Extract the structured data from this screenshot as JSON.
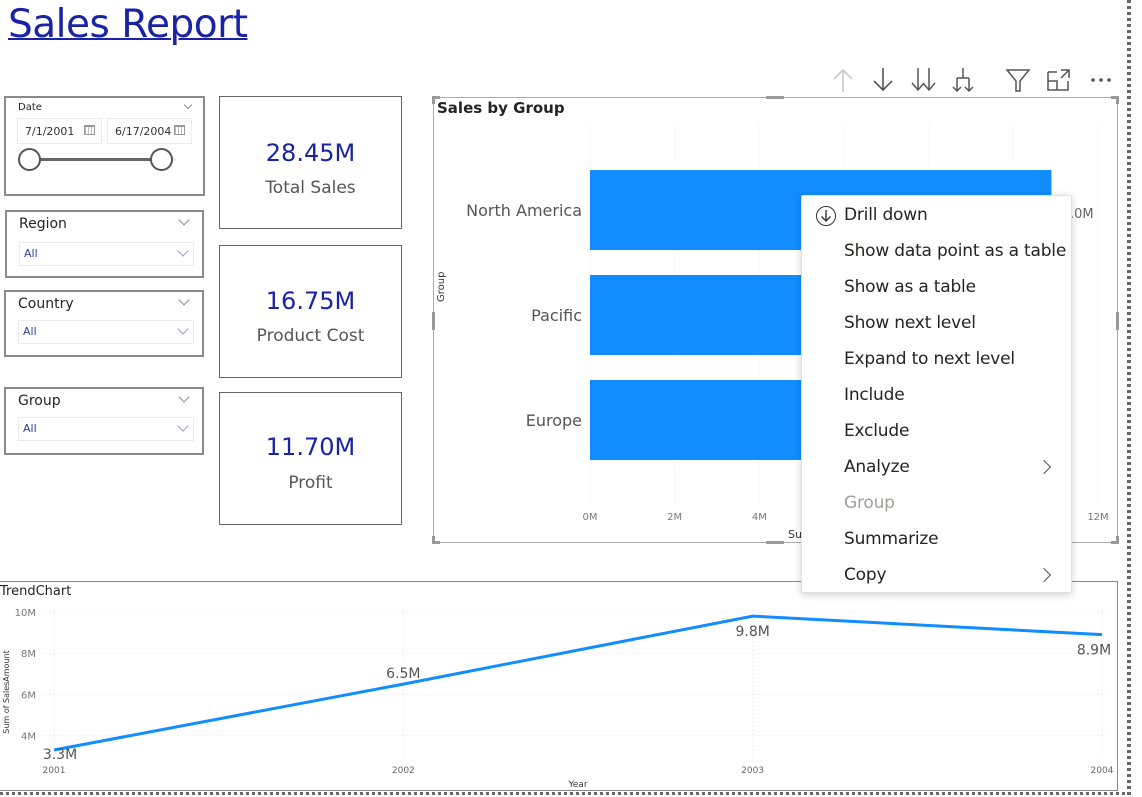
{
  "report": {
    "title": "Sales Report"
  },
  "slicers": {
    "date": {
      "label": "Date",
      "start": "7/1/2001",
      "end": "6/17/2004",
      "range_fraction": [
        0.0,
        1.0
      ]
    },
    "region": {
      "label": "Region",
      "value": "All"
    },
    "country": {
      "label": "Country",
      "value": "All"
    },
    "group": {
      "label": "Group",
      "value": "All"
    }
  },
  "cards": [
    {
      "value": "28.45M",
      "label": "Total Sales"
    },
    {
      "value": "16.75M",
      "label": "Product Cost"
    },
    {
      "value": "11.70M",
      "label": "Profit"
    }
  ],
  "visual_toolbar": [
    {
      "name": "drill-up-icon",
      "enabled": false
    },
    {
      "name": "drill-down-icon",
      "enabled": true
    },
    {
      "name": "go-to-next-level-icon",
      "enabled": true
    },
    {
      "name": "expand-next-level-icon",
      "enabled": true
    },
    {
      "name": "filter-icon",
      "enabled": true
    },
    {
      "name": "focus-mode-icon",
      "enabled": true
    },
    {
      "name": "more-options-icon",
      "enabled": true
    }
  ],
  "context_menu": {
    "items": [
      {
        "label": "Drill down",
        "icon": "drill-down-circle-icon",
        "disabled": false,
        "submenu": false
      },
      {
        "label": "Show data point as a table",
        "disabled": false,
        "submenu": false
      },
      {
        "label": "Show as a table",
        "disabled": false,
        "submenu": false
      },
      {
        "label": "Show next level",
        "disabled": false,
        "submenu": false
      },
      {
        "label": "Expand to next level",
        "disabled": false,
        "submenu": false
      },
      {
        "label": "Include",
        "disabled": false,
        "submenu": false
      },
      {
        "label": "Exclude",
        "disabled": false,
        "submenu": false
      },
      {
        "label": "Analyze",
        "disabled": false,
        "submenu": true
      },
      {
        "label": "Group",
        "disabled": true,
        "submenu": false
      },
      {
        "label": "Summarize",
        "disabled": false,
        "submenu": false
      },
      {
        "label": "Copy",
        "disabled": false,
        "submenu": true
      }
    ]
  },
  "chart_data": [
    {
      "type": "bar",
      "orientation": "horizontal",
      "title": "Sales by Group",
      "xlabel": "Su",
      "ylabel": "Group",
      "categories": [
        "North America",
        "Pacific",
        "Europe"
      ],
      "values": [
        10.9,
        null,
        null
      ],
      "data_labels": [
        "11.0M",
        "",
        ""
      ],
      "xlim": [
        0,
        12
      ],
      "x_ticks": [
        0,
        2,
        4,
        6,
        8,
        10,
        12
      ],
      "x_tick_labels_visible": [
        "0M",
        "2M",
        "4M",
        "12M"
      ],
      "color": "#118DFF",
      "grid": true,
      "note": "Pacific and Europe bar ends are hidden behind the context menu"
    },
    {
      "type": "line",
      "title": "TrendChart",
      "xlabel": "Year",
      "ylabel": "Sum of SalesAmount",
      "x": [
        "2001",
        "2002",
        "2003",
        "2004"
      ],
      "series": [
        {
          "name": "Sum of SalesAmount",
          "values": [
            3.3,
            6.5,
            9.8,
            8.9
          ]
        }
      ],
      "data_labels": [
        "3.3M",
        "6.5M",
        "9.8M",
        "8.9M"
      ],
      "y_ticks": [
        4,
        6,
        8,
        10
      ],
      "y_tick_labels": [
        "4M",
        "6M",
        "8M",
        "10M"
      ],
      "ylim": [
        3.3,
        10
      ],
      "color": "#118DFF",
      "grid": true
    }
  ],
  "colors": {
    "accent": "#118DFF",
    "title_link": "#1A23A8",
    "card_value": "#1A23A0"
  }
}
